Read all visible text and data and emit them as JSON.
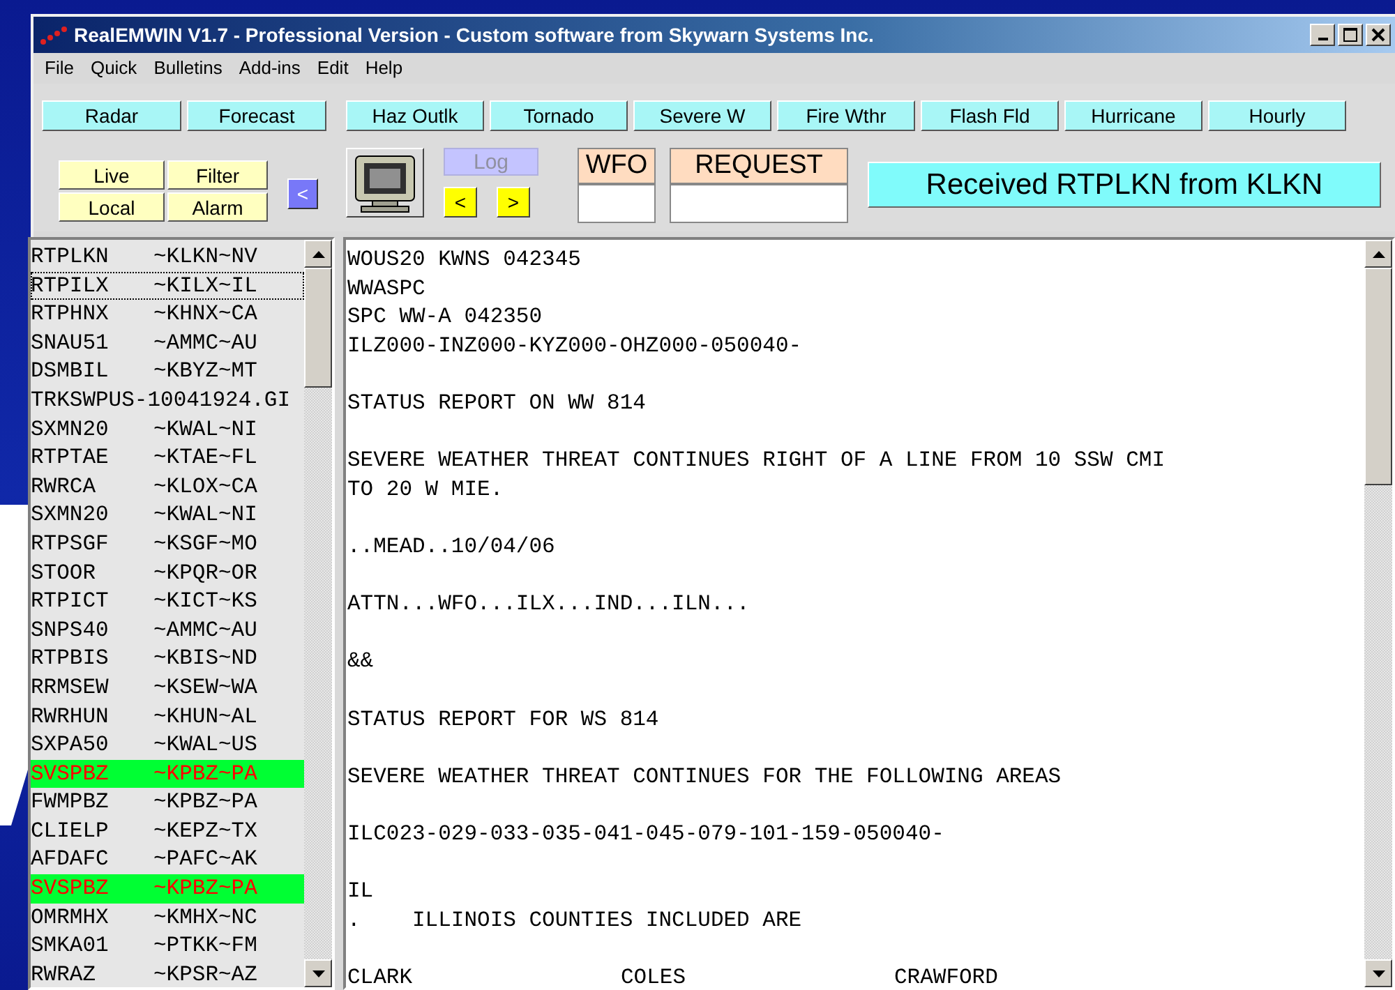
{
  "window": {
    "title": "RealEMWIN V1.7 - Professional Version - Custom software from Skywarn Systems Inc."
  },
  "menu": [
    "File",
    "Quick",
    "Bulletins",
    "Add-ins",
    "Edit",
    "Help"
  ],
  "view_buttons": [
    "Radar",
    "Forecast"
  ],
  "product_buttons": [
    "Haz Outlk",
    "Tornado",
    "Severe W",
    "Fire Wthr",
    "Flash Fld",
    "Hurricane",
    "Hourly"
  ],
  "mode_buttons": [
    "Live",
    "Filter",
    "Local",
    "Alarm"
  ],
  "back_button": "<",
  "log_button": {
    "label": "Log",
    "disabled": true
  },
  "nav_buttons": [
    "<",
    ">"
  ],
  "wfo": {
    "label": "WFO"
  },
  "request": {
    "label": "REQUEST"
  },
  "status": "Received RTPLKN from KLKN",
  "products": [
    {
      "name": "RTPLKN",
      "station": "~KLKN~NV",
      "alert": false,
      "focused": false
    },
    {
      "name": "RTPILX",
      "station": "~KILX~IL",
      "alert": false,
      "focused": true
    },
    {
      "name": "RTPHNX",
      "station": "~KHNX~CA",
      "alert": false,
      "focused": false
    },
    {
      "name": "SNAU51",
      "station": "~AMMC~AU",
      "alert": false,
      "focused": false
    },
    {
      "name": "DSMBIL",
      "station": "~KBYZ~MT",
      "alert": false,
      "focused": false
    },
    {
      "name": "TRKSWPUS-10041924.GI",
      "alert": false,
      "focused": false
    },
    {
      "name": "SXMN20",
      "station": "~KWAL~NI",
      "alert": false,
      "focused": false
    },
    {
      "name": "RTPTAE",
      "station": "~KTAE~FL",
      "alert": false,
      "focused": false
    },
    {
      "name": "RWRCA",
      "station": "~KLOX~CA",
      "alert": false,
      "focused": false
    },
    {
      "name": "SXMN20",
      "station": "~KWAL~NI",
      "alert": false,
      "focused": false
    },
    {
      "name": "RTPSGF",
      "station": "~KSGF~MO",
      "alert": false,
      "focused": false
    },
    {
      "name": "STOOR",
      "station": "~KPQR~OR",
      "alert": false,
      "focused": false
    },
    {
      "name": "RTPICT",
      "station": "~KICT~KS",
      "alert": false,
      "focused": false
    },
    {
      "name": "SNPS40",
      "station": "~AMMC~AU",
      "alert": false,
      "focused": false
    },
    {
      "name": "RTPBIS",
      "station": "~KBIS~ND",
      "alert": false,
      "focused": false
    },
    {
      "name": "RRMSEW",
      "station": "~KSEW~WA",
      "alert": false,
      "focused": false
    },
    {
      "name": "RWRHUN",
      "station": "~KHUN~AL",
      "alert": false,
      "focused": false
    },
    {
      "name": "SXPA50",
      "station": "~KWAL~US",
      "alert": false,
      "focused": false
    },
    {
      "name": "SVSPBZ",
      "station": "~KPBZ~PA",
      "alert": true,
      "focused": false
    },
    {
      "name": "FWMPBZ",
      "station": "~KPBZ~PA",
      "alert": false,
      "focused": false
    },
    {
      "name": "CLIELP",
      "station": "~KEPZ~TX",
      "alert": false,
      "focused": false
    },
    {
      "name": "AFDAFC",
      "station": "~PAFC~AK",
      "alert": false,
      "focused": false
    },
    {
      "name": "SVSPBZ",
      "station": "~KPBZ~PA",
      "alert": true,
      "focused": false
    },
    {
      "name": "OMRMHX",
      "station": "~KMHX~NC",
      "alert": false,
      "focused": false
    },
    {
      "name": "SMKA01",
      "station": "~PTKK~FM",
      "alert": false,
      "focused": false
    },
    {
      "name": "RWRAZ",
      "station": "~KPSR~AZ",
      "alert": false,
      "focused": false
    }
  ],
  "bulletin": [
    {
      "lines": [
        "WOUS20 KWNS 042345",
        "WWASPC",
        "SPC WW-A 042350",
        "ILZ000-INZ000-KYZ000-OHZ000-050040-"
      ]
    },
    {
      "lines": [
        "STATUS REPORT ON WW 814"
      ]
    },
    {
      "lines": [
        "SEVERE WEATHER THREAT CONTINUES RIGHT OF A LINE FROM 10 SSW CMI",
        "TO 20 W MIE."
      ]
    },
    {
      "lines": [
        "..MEAD..10/04/06"
      ]
    },
    {
      "lines": [
        "ATTN...WFO...ILX...IND...ILN..."
      ]
    },
    {
      "lines": [
        "&&"
      ]
    },
    {
      "lines": [
        "STATUS REPORT FOR WS 814"
      ]
    },
    {
      "lines": [
        "SEVERE WEATHER THREAT CONTINUES FOR THE FOLLOWING AREAS"
      ]
    },
    {
      "lines": [
        "ILC023-029-033-035-041-045-079-101-159-050040-"
      ]
    },
    {
      "lines": [
        "IL",
        ".    ILLINOIS COUNTIES INCLUDED ARE"
      ]
    },
    {
      "columns": [
        "CLARK",
        "COLES",
        "CRAWFORD"
      ]
    }
  ]
}
